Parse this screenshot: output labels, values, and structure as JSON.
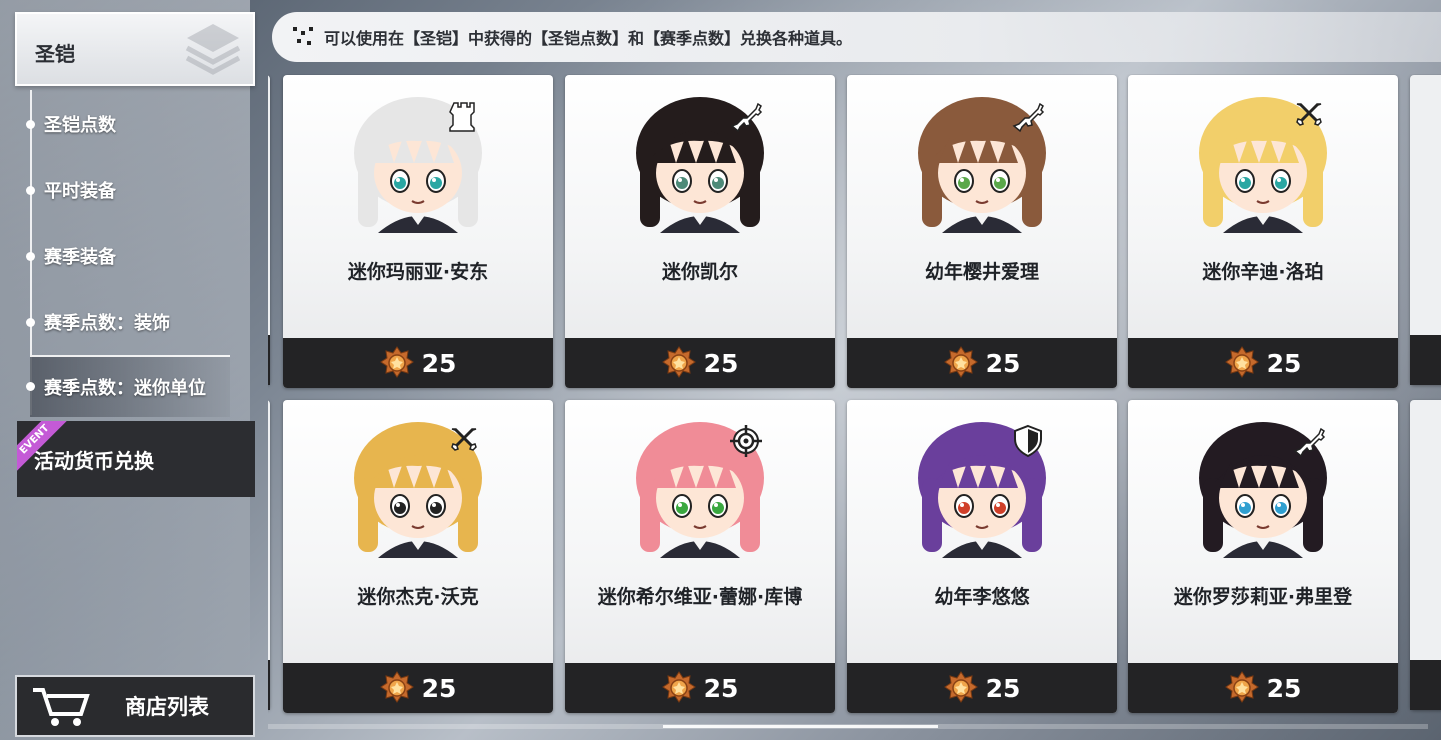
{
  "sidebar": {
    "title": "圣铠",
    "items": [
      {
        "label": "圣铠点数"
      },
      {
        "label": "平时装备"
      },
      {
        "label": "赛季装备"
      },
      {
        "label": "赛季点数：装饰"
      },
      {
        "label": "赛季点数：迷你单位"
      }
    ],
    "event_badge": "EVENT",
    "event_item": "活动货币兑换",
    "shop_list": "商店列表"
  },
  "notice": "可以使用在【圣铠】中获得的【圣铠点数】和【赛季点数】兑换各种道具。",
  "cards": [
    {
      "name": "迷你玛丽亚·安东",
      "price": "25",
      "role": "rook-icon",
      "hair": "#e6e6e6",
      "eyes": "#2aa7a3"
    },
    {
      "name": "迷你凯尔",
      "price": "25",
      "role": "rifle-icon",
      "hair": "#241c1c",
      "eyes": "#4d8a78"
    },
    {
      "name": "幼年樱井爱理",
      "price": "25",
      "role": "rifle-icon",
      "hair": "#8a5a3c",
      "eyes": "#5aa84a"
    },
    {
      "name": "迷你辛迪·洛珀",
      "price": "25",
      "role": "swords-icon",
      "hair": "#f2cf6a",
      "eyes": "#2aa7a3"
    },
    {
      "name": "迷你杰克·沃克",
      "price": "25",
      "role": "swords-icon",
      "hair": "#e7b54e",
      "eyes": "#222222"
    },
    {
      "name": "迷你希尔维亚·蕾娜·库博",
      "price": "25",
      "role": "crosshair-icon",
      "hair": "#f08c97",
      "eyes": "#3aa840"
    },
    {
      "name": "幼年李悠悠",
      "price": "25",
      "role": "shield-icon",
      "hair": "#6a3f9c",
      "eyes": "#d0402a"
    },
    {
      "name": "迷你罗莎莉亚·弗里登",
      "price": "25",
      "role": "rifle-icon",
      "hair": "#231b22",
      "eyes": "#2f9fd0"
    }
  ],
  "colors": {
    "price_bar": "#232325",
    "event_ribbon": "#c45ad6"
  }
}
